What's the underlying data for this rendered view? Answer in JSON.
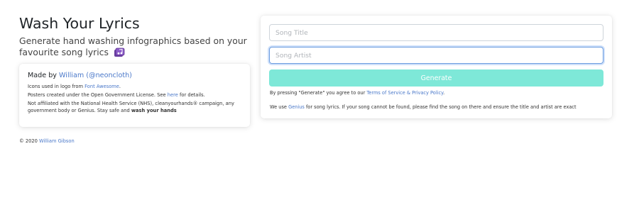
{
  "header": {
    "title": "Wash Your Lyrics",
    "subtitle": "Generate hand washing infographics based on your favourite song lyrics",
    "subtitle_icon": "music-icon"
  },
  "about": {
    "made_by_prefix": "Made by",
    "author_name": "William",
    "author_handle": "(@neoncloth)",
    "icons_prefix": "Icons used in logo from",
    "icons_link": "Font Awesome",
    "icons_suffix": ".",
    "license_prefix": "Posters created under the Open Government License. See",
    "license_link": "here",
    "license_suffix": "for details.",
    "disclaimer": "Not affiliated with the National Health Service (NHS), cleanyourhands® campaign, any government body or Genius. Stay safe and",
    "disclaimer_strong": "wash your hands"
  },
  "footer": {
    "copyright": "© 2020",
    "author_link": "William Gibson"
  },
  "form": {
    "song_title_placeholder": "Song Title",
    "song_artist_placeholder": "Song Artist",
    "generate_label": "Generate",
    "terms_prefix": "By pressing \"Generate\" you agree to our",
    "terms_link": "Terms of Service & Privacy Policy",
    "terms_suffix": ".",
    "genius_prefix": "We use",
    "genius_link": "Genius",
    "genius_suffix": "for song lyrics. If your song cannot be found, please find the song on there and ensure the title and artist are exact"
  },
  "colors": {
    "accent_link": "#4a78c9",
    "generate_button": "#7ee8d8",
    "focus_border": "#6b9ce0"
  }
}
